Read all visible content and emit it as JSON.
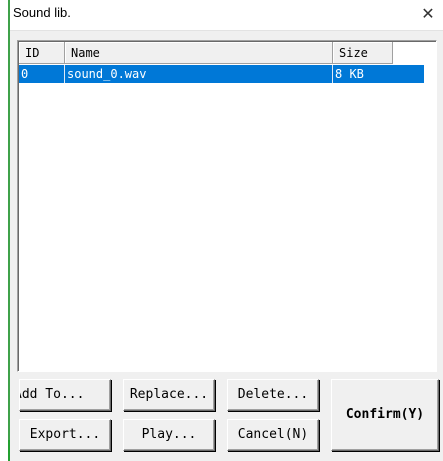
{
  "window": {
    "title": "Sound lib."
  },
  "list": {
    "columns": [
      "ID",
      "Name",
      "Size"
    ],
    "rows": [
      {
        "id": "0",
        "name": "sound_0.wav",
        "size": "8 KB"
      }
    ]
  },
  "buttons": {
    "add_to": "Add To...",
    "replace": "Replace...",
    "delete": "Delete...",
    "export": "Export...",
    "play": "Play...",
    "cancel": "Cancel(N)",
    "confirm": "Confirm(Y)"
  },
  "colors": {
    "selection": "#0078d7",
    "face": "#f0f0f0"
  },
  "icons": {
    "close": "close-icon"
  }
}
